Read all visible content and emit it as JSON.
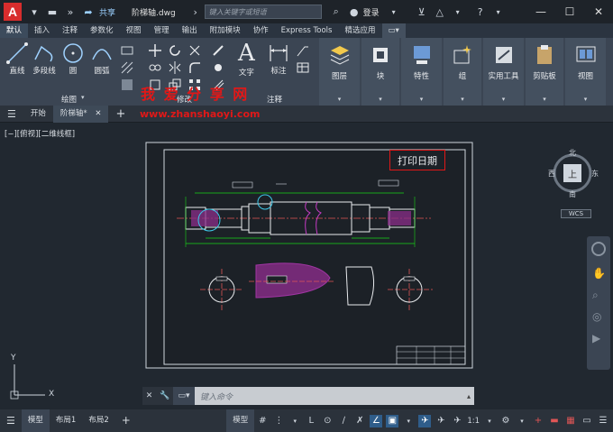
{
  "titlebar": {
    "app_letter": "A",
    "share_label": "共享",
    "doc_title": "阶梯轴.dwg",
    "search_placeholder": "键入关键字或短语",
    "login_label": "登录"
  },
  "ribbon_tabs": [
    "默认",
    "插入",
    "注释",
    "参数化",
    "视图",
    "管理",
    "输出",
    "附加模块",
    "协作",
    "Express Tools",
    "精选应用"
  ],
  "ribbon": {
    "draw_tools": [
      "直线",
      "多段线",
      "圆",
      "圆弧"
    ],
    "draw_panel_title": "绘图",
    "modify_panel_title": "修改",
    "text_tool": "文字",
    "dim_tool": "标注",
    "annotation_panel_title": "注释",
    "big_buttons": [
      "图层",
      "块",
      "特性",
      "组",
      "实用工具",
      "剪贴板",
      "视图"
    ]
  },
  "doc_tabs": {
    "start": "开始",
    "active": "阶梯轴*"
  },
  "canvas": {
    "view_label": "[−][俯视][二维线框]",
    "print_date_label": "打印日期",
    "viewcube": {
      "top": "上",
      "north": "北",
      "south": "南",
      "west": "西",
      "east": "东",
      "wcs": "WCS"
    },
    "ucs_x": "X",
    "ucs_y": "Y",
    "command_placeholder": "键入命令"
  },
  "watermark": {
    "title": "我 爱 分 享 网",
    "url": "www.zhanshaoyi.com"
  },
  "statusbar": {
    "tabs": [
      "模型",
      "布局1",
      "布局2"
    ],
    "model_label": "模型",
    "scale": "1:1"
  },
  "colors": {
    "accent_red": "#e01818",
    "drawing_green": "#19d519",
    "drawing_magenta": "#c23bc2",
    "drawing_cyan": "#3ec8e8"
  }
}
